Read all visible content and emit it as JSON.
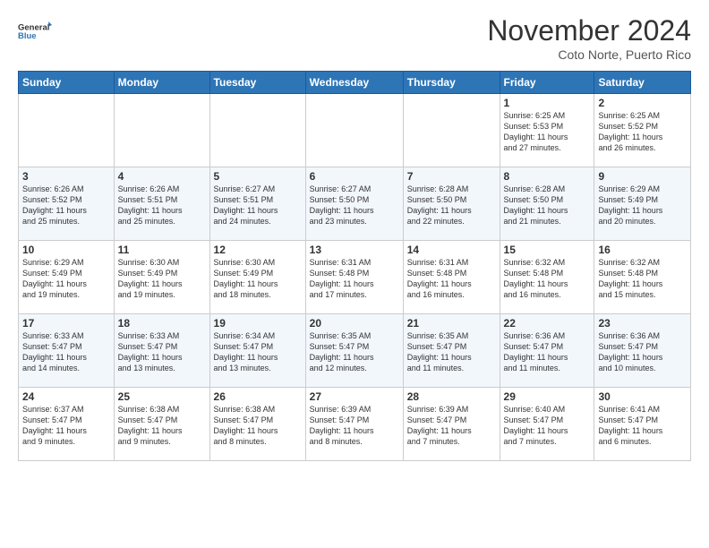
{
  "header": {
    "logo_line1": "General",
    "logo_line2": "Blue",
    "month_title": "November 2024",
    "subtitle": "Coto Norte, Puerto Rico"
  },
  "weekdays": [
    "Sunday",
    "Monday",
    "Tuesday",
    "Wednesday",
    "Thursday",
    "Friday",
    "Saturday"
  ],
  "weeks": [
    [
      {
        "day": "",
        "info": ""
      },
      {
        "day": "",
        "info": ""
      },
      {
        "day": "",
        "info": ""
      },
      {
        "day": "",
        "info": ""
      },
      {
        "day": "",
        "info": ""
      },
      {
        "day": "1",
        "info": "Sunrise: 6:25 AM\nSunset: 5:53 PM\nDaylight: 11 hours\nand 27 minutes."
      },
      {
        "day": "2",
        "info": "Sunrise: 6:25 AM\nSunset: 5:52 PM\nDaylight: 11 hours\nand 26 minutes."
      }
    ],
    [
      {
        "day": "3",
        "info": "Sunrise: 6:26 AM\nSunset: 5:52 PM\nDaylight: 11 hours\nand 25 minutes."
      },
      {
        "day": "4",
        "info": "Sunrise: 6:26 AM\nSunset: 5:51 PM\nDaylight: 11 hours\nand 25 minutes."
      },
      {
        "day": "5",
        "info": "Sunrise: 6:27 AM\nSunset: 5:51 PM\nDaylight: 11 hours\nand 24 minutes."
      },
      {
        "day": "6",
        "info": "Sunrise: 6:27 AM\nSunset: 5:50 PM\nDaylight: 11 hours\nand 23 minutes."
      },
      {
        "day": "7",
        "info": "Sunrise: 6:28 AM\nSunset: 5:50 PM\nDaylight: 11 hours\nand 22 minutes."
      },
      {
        "day": "8",
        "info": "Sunrise: 6:28 AM\nSunset: 5:50 PM\nDaylight: 11 hours\nand 21 minutes."
      },
      {
        "day": "9",
        "info": "Sunrise: 6:29 AM\nSunset: 5:49 PM\nDaylight: 11 hours\nand 20 minutes."
      }
    ],
    [
      {
        "day": "10",
        "info": "Sunrise: 6:29 AM\nSunset: 5:49 PM\nDaylight: 11 hours\nand 19 minutes."
      },
      {
        "day": "11",
        "info": "Sunrise: 6:30 AM\nSunset: 5:49 PM\nDaylight: 11 hours\nand 19 minutes."
      },
      {
        "day": "12",
        "info": "Sunrise: 6:30 AM\nSunset: 5:49 PM\nDaylight: 11 hours\nand 18 minutes."
      },
      {
        "day": "13",
        "info": "Sunrise: 6:31 AM\nSunset: 5:48 PM\nDaylight: 11 hours\nand 17 minutes."
      },
      {
        "day": "14",
        "info": "Sunrise: 6:31 AM\nSunset: 5:48 PM\nDaylight: 11 hours\nand 16 minutes."
      },
      {
        "day": "15",
        "info": "Sunrise: 6:32 AM\nSunset: 5:48 PM\nDaylight: 11 hours\nand 16 minutes."
      },
      {
        "day": "16",
        "info": "Sunrise: 6:32 AM\nSunset: 5:48 PM\nDaylight: 11 hours\nand 15 minutes."
      }
    ],
    [
      {
        "day": "17",
        "info": "Sunrise: 6:33 AM\nSunset: 5:47 PM\nDaylight: 11 hours\nand 14 minutes."
      },
      {
        "day": "18",
        "info": "Sunrise: 6:33 AM\nSunset: 5:47 PM\nDaylight: 11 hours\nand 13 minutes."
      },
      {
        "day": "19",
        "info": "Sunrise: 6:34 AM\nSunset: 5:47 PM\nDaylight: 11 hours\nand 13 minutes."
      },
      {
        "day": "20",
        "info": "Sunrise: 6:35 AM\nSunset: 5:47 PM\nDaylight: 11 hours\nand 12 minutes."
      },
      {
        "day": "21",
        "info": "Sunrise: 6:35 AM\nSunset: 5:47 PM\nDaylight: 11 hours\nand 11 minutes."
      },
      {
        "day": "22",
        "info": "Sunrise: 6:36 AM\nSunset: 5:47 PM\nDaylight: 11 hours\nand 11 minutes."
      },
      {
        "day": "23",
        "info": "Sunrise: 6:36 AM\nSunset: 5:47 PM\nDaylight: 11 hours\nand 10 minutes."
      }
    ],
    [
      {
        "day": "24",
        "info": "Sunrise: 6:37 AM\nSunset: 5:47 PM\nDaylight: 11 hours\nand 9 minutes."
      },
      {
        "day": "25",
        "info": "Sunrise: 6:38 AM\nSunset: 5:47 PM\nDaylight: 11 hours\nand 9 minutes."
      },
      {
        "day": "26",
        "info": "Sunrise: 6:38 AM\nSunset: 5:47 PM\nDaylight: 11 hours\nand 8 minutes."
      },
      {
        "day": "27",
        "info": "Sunrise: 6:39 AM\nSunset: 5:47 PM\nDaylight: 11 hours\nand 8 minutes."
      },
      {
        "day": "28",
        "info": "Sunrise: 6:39 AM\nSunset: 5:47 PM\nDaylight: 11 hours\nand 7 minutes."
      },
      {
        "day": "29",
        "info": "Sunrise: 6:40 AM\nSunset: 5:47 PM\nDaylight: 11 hours\nand 7 minutes."
      },
      {
        "day": "30",
        "info": "Sunrise: 6:41 AM\nSunset: 5:47 PM\nDaylight: 11 hours\nand 6 minutes."
      }
    ]
  ]
}
